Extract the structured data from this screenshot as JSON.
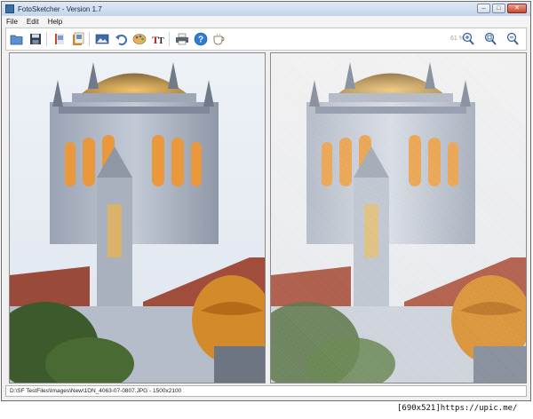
{
  "window": {
    "title": "FotoSketcher - Version 1.7"
  },
  "menu": {
    "items": [
      "File",
      "Edit",
      "Help"
    ]
  },
  "toolbar": {
    "zoom_label": "61 %"
  },
  "status": {
    "path": "D:\\SF TestFiles\\Images\\New\\1DN_4063-07-0807.JPG - 1500x2100"
  },
  "watermark": "[690x521]https://upic.me/",
  "colors": {
    "title_gradient_top": "#dfe9f5",
    "title_gradient_bottom": "#c4d5ea",
    "sky": "#e6ecf4",
    "dome": "#c9a25a",
    "stone": "#b4bccb",
    "roof": "#9a4a3a"
  },
  "icons": [
    "folder-open-icon",
    "save-icon",
    "book-icon",
    "book-copy-icon",
    "picture-icon",
    "undo-icon",
    "palette-icon",
    "text-icon",
    "printer-icon",
    "help-icon",
    "coffee-icon",
    "zoom-in-icon",
    "zoom-fit-icon",
    "zoom-out-icon"
  ]
}
